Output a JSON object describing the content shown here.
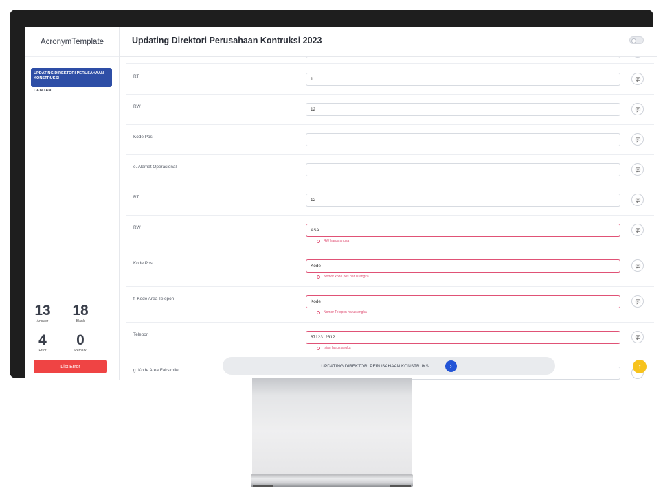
{
  "brand": "AcronymTemplate",
  "header": {
    "title": "Updating Direktori Perusahaan Kontruksi 2023"
  },
  "sidebar": {
    "items": [
      {
        "label": "UPDATING DIREKTORI PERUSAHAAN KONSTRUKSI",
        "active": true
      },
      {
        "label": "CATATAN",
        "active": false
      }
    ],
    "stats": [
      {
        "value": "13",
        "label": "Answer"
      },
      {
        "value": "18",
        "label": "Blank"
      },
      {
        "value": "4",
        "label": "Error"
      },
      {
        "value": "0",
        "label": "Remark"
      }
    ],
    "list_error_label": "List Error"
  },
  "form": {
    "rows": [
      {
        "label": "RT",
        "value": "1",
        "error": ""
      },
      {
        "label": "RW",
        "value": "12",
        "error": ""
      },
      {
        "label": "Kode Pos",
        "value": "",
        "error": ""
      },
      {
        "label": "e. Alamat Operasional",
        "value": "",
        "error": ""
      },
      {
        "label": "RT",
        "value": "12",
        "error": ""
      },
      {
        "label": "RW",
        "value": "ASA",
        "error": "RW harus angka"
      },
      {
        "label": "Kode Pos",
        "value": "Kode",
        "error": "Nomor kode pos harus angka"
      },
      {
        "label": "f. Kode Area Telepon",
        "value": "Kode",
        "error": "Nomor Telepon harus angka"
      },
      {
        "label": "Telepon",
        "value": "8712312312",
        "error": "Isian harus angka"
      },
      {
        "label": "g. Kode Area Faksimile",
        "value": "",
        "error": ""
      }
    ]
  },
  "bottom_bar": {
    "label": "UPDATING DIREKTORI PERUSAHAAN KONSTRUKSI"
  },
  "colors": {
    "accent": "#2E4EA6",
    "error": "#E05276",
    "list_error_button": "#EF4444",
    "scroll_up": "#F7C31D",
    "next_button": "#2354D6"
  }
}
